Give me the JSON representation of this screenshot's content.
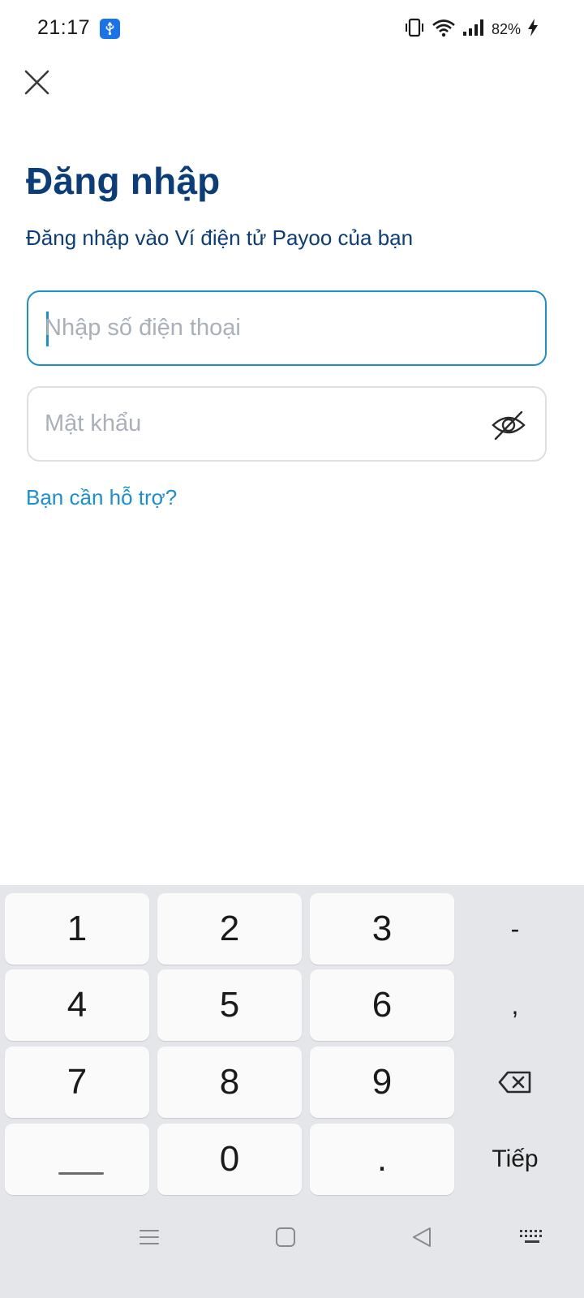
{
  "status_bar": {
    "time": "21:17",
    "battery": "82%",
    "icons": [
      "usb-icon",
      "vibrate-icon",
      "wifi-icon",
      "signal-icon",
      "charging-icon"
    ]
  },
  "header": {
    "close_icon": "close-icon"
  },
  "login": {
    "title": "Đăng nhập",
    "subtitle": "Đăng nhập vào Ví điện tử Payoo của bạn",
    "phone_placeholder": "Nhập số điện thoại",
    "phone_value": "",
    "password_placeholder": "Mật khẩu",
    "password_value": "",
    "password_toggle_icon": "eye-off-icon",
    "help_link": "Bạn cần hỗ trợ?"
  },
  "colors": {
    "brand_dark": "#0a3d7a",
    "accent": "#1a8fd1",
    "keyboard_bg": "#e5e6ea"
  },
  "keyboard": {
    "keys": [
      "1",
      "2",
      "3",
      "4",
      "5",
      "6",
      "7",
      "8",
      "9",
      "0",
      "."
    ],
    "side_keys": [
      "-",
      ",",
      "Tiếp"
    ],
    "backspace_icon": "backspace-icon",
    "space_icon": "space-icon"
  },
  "nav_bar": {
    "icons": [
      "menu-icon",
      "home-icon",
      "back-icon",
      "keyboard-icon"
    ]
  }
}
